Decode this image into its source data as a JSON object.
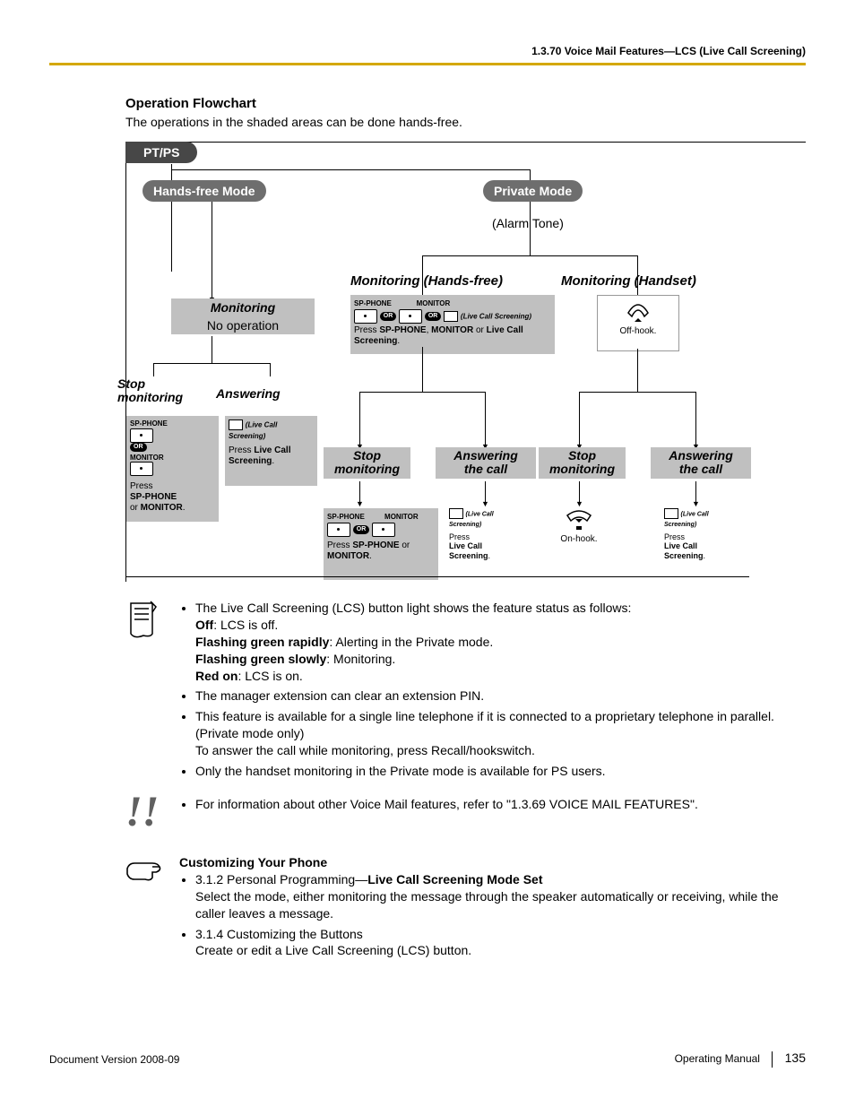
{
  "header": "1.3.70 Voice Mail Features—LCS (Live Call Screening)",
  "title": "Operation Flowchart",
  "intro": "The operations in the shaded areas can be done hands-free.",
  "fc": {
    "ptps": "PT/PS",
    "handsfree": "Hands-free Mode",
    "private": "Private Mode",
    "alarm": "(Alarm Tone)",
    "mon_hf": "Monitoring (Hands-free)",
    "mon_hs": "Monitoring (Handset)",
    "monitoring": "Monitoring",
    "noop": "No operation",
    "stopmon": "Stop monitoring",
    "answering": "Answering",
    "answcall": "Answering the call",
    "offhook": "Off-hook.",
    "onhook": "On-hook.",
    "sp": "SP-PHONE",
    "mo": "MONITOR",
    "lcs": "(Live Call Screening)",
    "press_lcs": "Press Live Call Screening.",
    "press_spmo": "Press SP-PHONE or MONITOR.",
    "press_all": "Press SP-PHONE, MONITOR or Live Call Screening.",
    "press_lcs2": "Press Live Call Screening.",
    "or": "OR"
  },
  "notes1": {
    "i1": "The Live Call Screening (LCS) button light shows the feature status as follows:",
    "off_b": "Off",
    "off_t": ": LCS is off.",
    "fgr_b": "Flashing green rapidly",
    "fgr_t": ": Alerting in the Private mode.",
    "fgs_b": "Flashing green slowly",
    "fgs_t": ": Monitoring.",
    "red_b": "Red on",
    "red_t": ": LCS is on.",
    "i2": "The manager extension can clear an extension PIN.",
    "i3a": "This feature is available for a single line telephone if it is connected to a proprietary telephone in parallel. (Private mode only)",
    "i3b": "To answer the call while monitoring, press Recall/hookswitch.",
    "i4": "Only the handset monitoring in the Private mode is available for PS users."
  },
  "notes2": {
    "i1": "For information about other Voice Mail features, refer to \"1.3.69  VOICE MAIL FEATURES\"."
  },
  "notes3": {
    "title": "Customizing Your Phone",
    "i1a": "3.1.2  Personal Programming—",
    "i1b": "Live Call Screening Mode Set",
    "i1c": "Select the mode, either monitoring the message through the speaker automatically or receiving, while the caller leaves a message.",
    "i2a": "3.1.4  Customizing the Buttons",
    "i2b": "Create or edit a Live Call Screening (LCS) button."
  },
  "footer": {
    "left": "Document Version  2008-09",
    "right": "Operating Manual",
    "page": "135"
  }
}
